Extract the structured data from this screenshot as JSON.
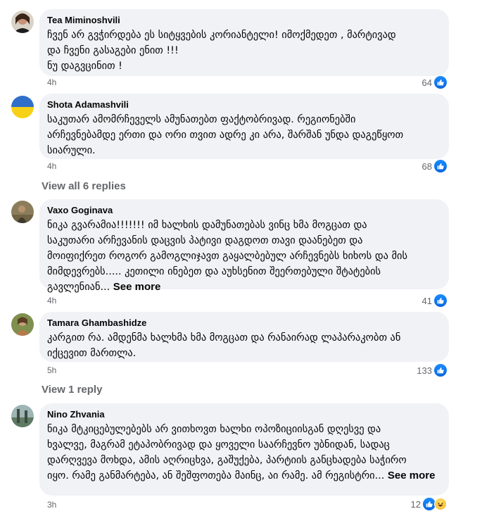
{
  "comments": [
    {
      "author": "Tea Miminoshvili",
      "text": "ჩვენ არ გვჭირდება ეს სიტყვების კორიანტელი! იმოქმედეთ , მარტივად\nდა ჩვენი გასაგები ენით !!!\nნუ დაგვცინით !",
      "time": "4h",
      "reactions": "64"
    },
    {
      "author": "Shota Adamashvili",
      "text": "საკუთარ ამომრჩეველს ამუნათებთ ფაქტობრივად. რეგიონებში\nარჩევნებამდე ერთი და ორი თვით ადრე კი არა, შარშან უნდა დაგეწყოთ\nსიარული.",
      "time": "4h",
      "reactions": "68"
    },
    {
      "author": "Vaxo Goginava",
      "text": "ნიკა გვარამია!!!!!!! იმ ხალხის დამუნათებას ვინც ხმა მოგცათ და\nსაკუთარი არჩევანის დაცვის პატივი დაგდოთ თავი დაანებეთ და\nმოიფიქრეთ როგორ გამოგლიჯავთ გაყალბებულ არჩევნებს ხიხოს და მის\nმიმდევრებს..... კეთილი ინებეთ და აუხსენით შეერთებული შტატების\nგავლენიან...",
      "see_more": "See more",
      "time": "4h",
      "reactions": "41"
    },
    {
      "author": "Tamara Ghambashidze",
      "text": "კარგით რა. ამდენმა ხალხმა ხმა მოგცათ და რანაირად ლაპარაკობთ ან\nიქცევით მართლა.",
      "time": "5h",
      "reactions": "133"
    },
    {
      "author": "Nino Zhvania",
      "text": "ნიკა მტკიცებულებებს არ ვითხოვთ ხალხი ოპოზიციისგან დღესვე და\nხვალვე, მაგრამ ეტაპობრივად და ყოველი საარჩევნო უბნიდან, სადაც\nდარღვევა მოხდა, ამის აღრიცხვა, გაშუქება, პარტიის განცხადება საჭირო\nიყო. რამე განმარტება, ან შეშფოთება მაინც, აი რამე. ამ რეგისტრი...",
      "see_more": "See more",
      "time": "3h",
      "reactions": "12"
    }
  ],
  "view_replies_1": "View all 6 replies",
  "view_replies_2": "View 1 reply",
  "colors": {
    "bubble": "#f0f2f5",
    "secondary_text": "#65676b",
    "like_blue": "#1877f2"
  },
  "icons": [
    "like-icon",
    "haha-icon"
  ]
}
